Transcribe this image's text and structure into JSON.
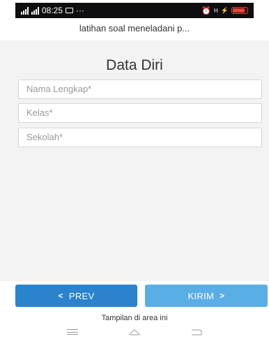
{
  "status_bar": {
    "network": "46",
    "time": "08:25",
    "more": "···",
    "right_label": "⁴⁶",
    "battery_color": "#ff3b3b"
  },
  "app_bar": {
    "title": "latihan soal meneladani p..."
  },
  "form": {
    "heading": "Data Diri",
    "fields": [
      {
        "placeholder": "Nama Lengkap*"
      },
      {
        "placeholder": "Kelas*"
      },
      {
        "placeholder": "Sekolah*"
      }
    ]
  },
  "buttons": {
    "prev_label": "PREV",
    "prev_chevron": "<",
    "next_label": "KIRIM",
    "next_chevron": ">",
    "prev_color": "#2a83cc",
    "next_color": "#5aaee6"
  },
  "footer": {
    "note": "Tampilan di area ini"
  },
  "navigation": {
    "icons": [
      "menu-icon",
      "home-icon",
      "back-icon"
    ]
  }
}
